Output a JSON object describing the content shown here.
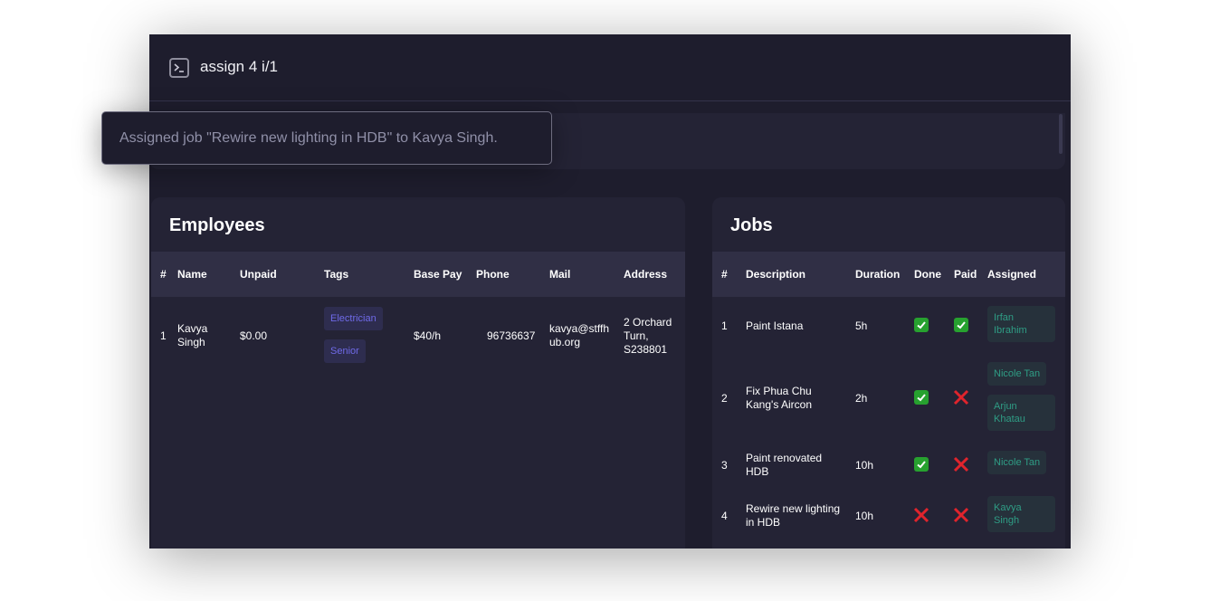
{
  "command": {
    "text": "assign 4 i/1",
    "icon": "terminal-icon"
  },
  "toast": {
    "message": "Assigned job \"Rewire new lighting in HDB\" to Kavya Singh."
  },
  "employees": {
    "title": "Employees",
    "columns": [
      "#",
      "Name",
      "Unpaid",
      "Tags",
      "Base Pay",
      "Phone",
      "Mail",
      "Address"
    ],
    "rows": [
      {
        "index": "1",
        "name": "Kavya Singh",
        "unpaid": "$0.00",
        "tags": [
          "Electrician",
          "Senior"
        ],
        "base_pay": "$40/h",
        "phone": "96736637",
        "mail": "kavya@stffhub.org",
        "address": "2 Orchard Turn, S238801"
      }
    ]
  },
  "jobs": {
    "title": "Jobs",
    "columns": [
      "#",
      "Description",
      "Duration",
      "Done",
      "Paid",
      "Assigned"
    ],
    "rows": [
      {
        "index": "1",
        "description": "Paint Istana",
        "duration": "5h",
        "done": true,
        "paid": true,
        "assigned": [
          "Irfan Ibrahim"
        ]
      },
      {
        "index": "2",
        "description": "Fix Phua Chu Kang's Aircon",
        "duration": "2h",
        "done": true,
        "paid": false,
        "assigned": [
          "Nicole Tan",
          "Arjun Khatau"
        ]
      },
      {
        "index": "3",
        "description": "Paint renovated HDB",
        "duration": "10h",
        "done": true,
        "paid": false,
        "assigned": [
          "Nicole Tan"
        ]
      },
      {
        "index": "4",
        "description": "Rewire new lighting in HDB",
        "duration": "10h",
        "done": false,
        "paid": false,
        "assigned": [
          "Kavya Singh"
        ]
      }
    ]
  },
  "colors": {
    "check": "#27a12f",
    "cross": "#e0242c",
    "tag_text": "#6f6ae8",
    "assignee_text": "#2f9d85"
  }
}
